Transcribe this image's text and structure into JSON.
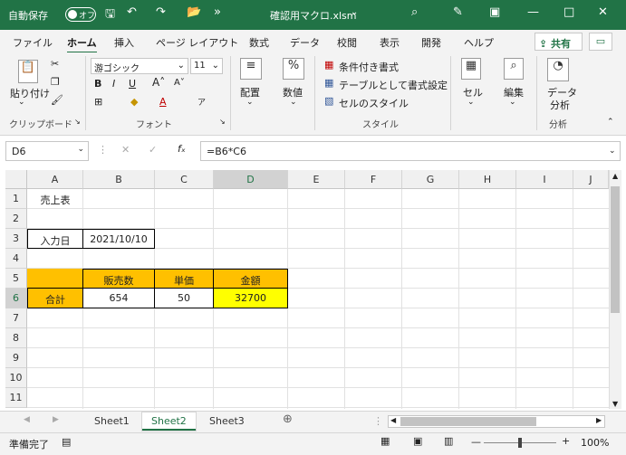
{
  "titlebar": {
    "autosave": "自動保存",
    "toggle": "オフ",
    "filename": "確認用マクロ.xlsm",
    "bg_color": "#217346"
  },
  "tabs": [
    {
      "label": "ファイル"
    },
    {
      "label": "ホーム"
    },
    {
      "label": "挿入"
    },
    {
      "label": "ページ レイアウト"
    },
    {
      "label": "数式"
    },
    {
      "label": "データ"
    },
    {
      "label": "校閲"
    },
    {
      "label": "表示"
    },
    {
      "label": "開発"
    },
    {
      "label": "ヘルプ"
    }
  ],
  "share_label": "共有",
  "ribbon": {
    "paste": "貼り付け",
    "clipboard": "クリップボード",
    "font_name": "游ゴシック",
    "font_size": "11",
    "font_group": "フォント",
    "align": "配置",
    "number": "数値",
    "cond_format": "条件付き書式",
    "table_format": "テーブルとして書式設定",
    "cell_style": "セルのスタイル",
    "style_group": "スタイル",
    "cell": "セル",
    "edit": "編集",
    "data_analysis_1": "データ",
    "data_analysis_2": "分析",
    "analysis_group": "分析"
  },
  "formula_bar": {
    "name_box": "D6",
    "formula": "=B6*C6"
  },
  "columns": [
    "A",
    "B",
    "C",
    "D",
    "E",
    "F",
    "G",
    "H",
    "I",
    "J"
  ],
  "rows": [
    "1",
    "2",
    "3",
    "4",
    "5",
    "6",
    "7",
    "8",
    "9",
    "10",
    "11"
  ],
  "cells": {
    "A1": "売上表",
    "A3": "入力日",
    "B3": "2021/10/10",
    "B5": "販売数",
    "C5": "単価",
    "D5": "金額",
    "A6": "合計",
    "B6": "654",
    "C6": "50",
    "D6": "32700"
  },
  "colors": {
    "header_fill": "#ffc000",
    "total_fill": "#ffff00",
    "accent": "#217346"
  },
  "sheets": [
    {
      "label": "Sheet1"
    },
    {
      "label": "Sheet2",
      "active": true
    },
    {
      "label": "Sheet3"
    }
  ],
  "status": {
    "ready": "準備完了",
    "zoom": "100%"
  }
}
